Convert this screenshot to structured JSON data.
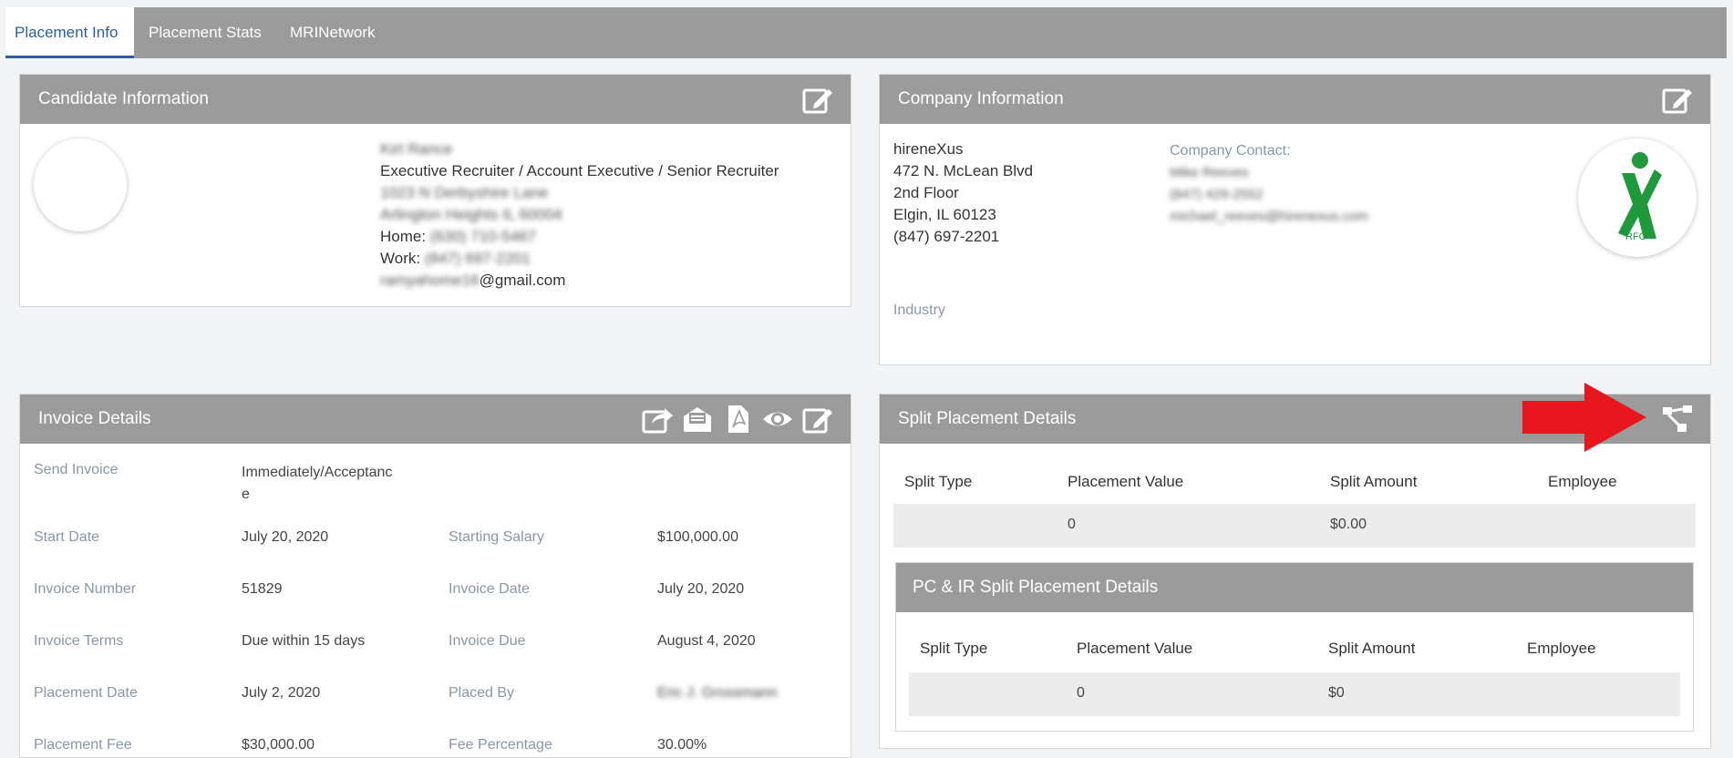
{
  "tabs": [
    {
      "label": "Placement Info"
    },
    {
      "label": "Placement Stats"
    },
    {
      "label": "MRINetwork"
    }
  ],
  "candidate": {
    "title": "Candidate Information",
    "name": "Kirt Rance",
    "position": "Executive Recruiter / Account Executive / Senior Recruiter",
    "address1": "1023 N Derbyshire Lane",
    "address2": "Arlington Heights IL 60004",
    "home_label": "Home:",
    "home_value": "(630) 710-5467",
    "work_label": "Work:",
    "work_value": "(847) 697-2201",
    "email_prefix": "ramyahome16",
    "email_suffix": "@gmail.com"
  },
  "company": {
    "title": "Company Information",
    "name": "hireneXus",
    "address1": "472 N. McLean Blvd",
    "address2": "2nd Floor",
    "city": "Elgin, IL 60123",
    "phone": "(847) 697-2201",
    "contact_label": "Company Contact:",
    "contact_name": "Mike Reeves",
    "contact_phone": "(847) 429-2552",
    "contact_email": "michael_reeves@hirenexus.com",
    "industry_label": "Industry",
    "logo_text": "RFC",
    "logo_color": "#1e9a3c"
  },
  "invoice": {
    "title": "Invoice Details",
    "icons": [
      "share-icon",
      "email-open-icon",
      "pdf-icon",
      "eye-icon",
      "edit-icon"
    ],
    "send_invoice_label": "Send Invoice",
    "send_invoice_line1": "Immediately/Acceptanc",
    "send_invoice_line2": "e",
    "rows": [
      {
        "l1": "Start Date",
        "v1": "July 20, 2020",
        "l2": "Starting Salary",
        "v2": "$100,000.00"
      },
      {
        "l1": "Invoice Number",
        "v1": "51829",
        "l2": "Invoice Date",
        "v2": "July 20, 2020"
      },
      {
        "l1": "Invoice Terms",
        "v1": "Due within 15 days",
        "l2": "Invoice Due",
        "v2": "August 4, 2020"
      },
      {
        "l1": "Placement Date",
        "v1": "July 2, 2020",
        "l2": "Placed By",
        "v2": "Eric J. Grossmann"
      },
      {
        "l1": "Placement Fee",
        "v1": "$30,000.00",
        "l2": "Fee Percentage",
        "v2": "30.00%"
      }
    ]
  },
  "split": {
    "title": "Split Placement Details",
    "columns": [
      "Split Type",
      "Placement Value",
      "Split Amount",
      "Employee"
    ],
    "row": [
      "",
      "0",
      "$0.00",
      ""
    ],
    "arrow_color": "#e8161d"
  },
  "pcir": {
    "title": "PC & IR Split Placement Details",
    "columns": [
      "Split Type",
      "Placement Value",
      "Split Amount",
      "Employee"
    ],
    "row": [
      "",
      "0",
      "$0",
      ""
    ]
  }
}
